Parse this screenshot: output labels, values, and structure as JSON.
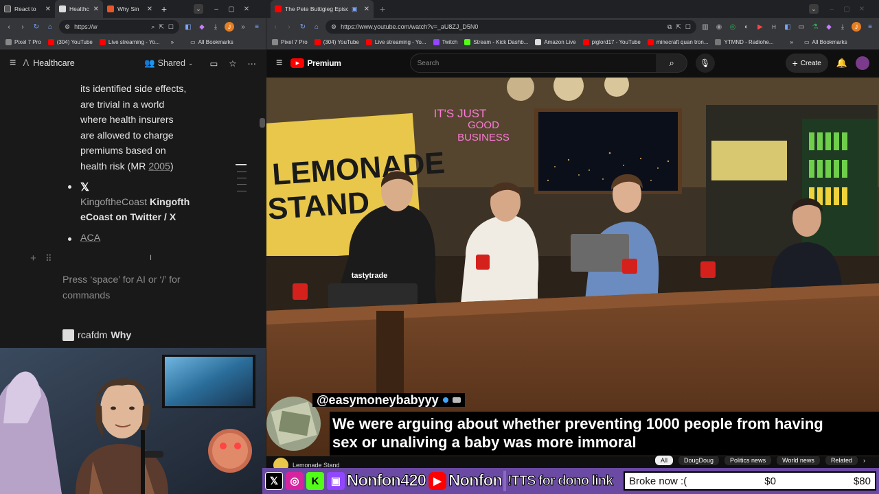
{
  "left_browser": {
    "tabs": [
      {
        "label": "React to",
        "color": "#3b3b3b"
      },
      {
        "label": "Healthc",
        "color": "#8a8a8a"
      },
      {
        "label": "Why Sin",
        "color": "#e8562a"
      }
    ],
    "url": "https://w",
    "bookmarks": [
      {
        "label": "Pixel 7 Pro",
        "color": "#888"
      },
      {
        "label": "(304) YouTube",
        "color": "#ff0000"
      },
      {
        "label": "Live streaming - Yo...",
        "color": "#ff0000"
      }
    ],
    "all_bookmarks": "All Bookmarks",
    "notion": {
      "page_title": "Healthcare",
      "shared_label": "Shared",
      "lines": [
        "its identified side effects,",
        "are trivial in a world",
        "where health insurers",
        "are allowed to charge",
        "premiums based on"
      ],
      "last_line_prefix": "health risk (MR ",
      "last_line_link": "2005",
      "last_line_suffix": ")",
      "twitter_user": "KingoftheCoast",
      "twitter_title_1": "Kingofth",
      "twitter_title_2": "eCoast on Twitter / X",
      "aca_link": "ACA",
      "placeholder_1": "Press ‘space’ for AI or ‘/’ for",
      "placeholder_2": "commands",
      "footer_user": "rcafdm",
      "footer_title": "Why"
    }
  },
  "right_browser": {
    "tab_label": "The Pete Buttigieg Episode",
    "url": "https://www.youtube.com/watch?v=_aU8ZJ_D5N0",
    "bookmarks": [
      {
        "label": "Pixel 7 Pro",
        "color": "#888"
      },
      {
        "label": "(304) YouTube",
        "color": "#ff0000"
      },
      {
        "label": "Live streaming - Yo...",
        "color": "#ff0000"
      },
      {
        "label": "Twitch",
        "color": "#9146ff"
      },
      {
        "label": "Stream - Kick Dashb...",
        "color": "#53fc18"
      },
      {
        "label": "Amazon Live",
        "color": "#ddd"
      },
      {
        "label": "piglord17 - YouTube",
        "color": "#ff0000"
      },
      {
        "label": "minecraft quan tron...",
        "color": "#ff0000"
      },
      {
        "label": "YTMND - Radiohe...",
        "color": "#777"
      }
    ],
    "all_bookmarks": "All Bookmarks",
    "youtube": {
      "logo_text": "Premium",
      "search_placeholder": "Search",
      "create_label": "Create",
      "neon_sign": [
        "IT'S JUST",
        "GOOD",
        "BUSINESS"
      ],
      "mug_brand": "tastytrade",
      "lemonade_sign": "LEMONADE STAND",
      "channel_name": "Lemonade Stand",
      "chips": [
        "All",
        "DougDoug",
        "Politics news",
        "World news",
        "Related"
      ]
    }
  },
  "donation": {
    "username": "@easymoneybabyyy",
    "message_1": "We were arguing about whether preventing 1000 people from having",
    "message_2": "sex or unaliving a baby was more immoral"
  },
  "stream_overlay": {
    "handle_1": "Nonfon420",
    "handle_2": "Nonfon",
    "tts_text": "!TTS for dono link",
    "goal_label": "Broke now :(",
    "goal_current": "$0",
    "goal_target": "$80",
    "bar_color": "#6a4aa3"
  }
}
